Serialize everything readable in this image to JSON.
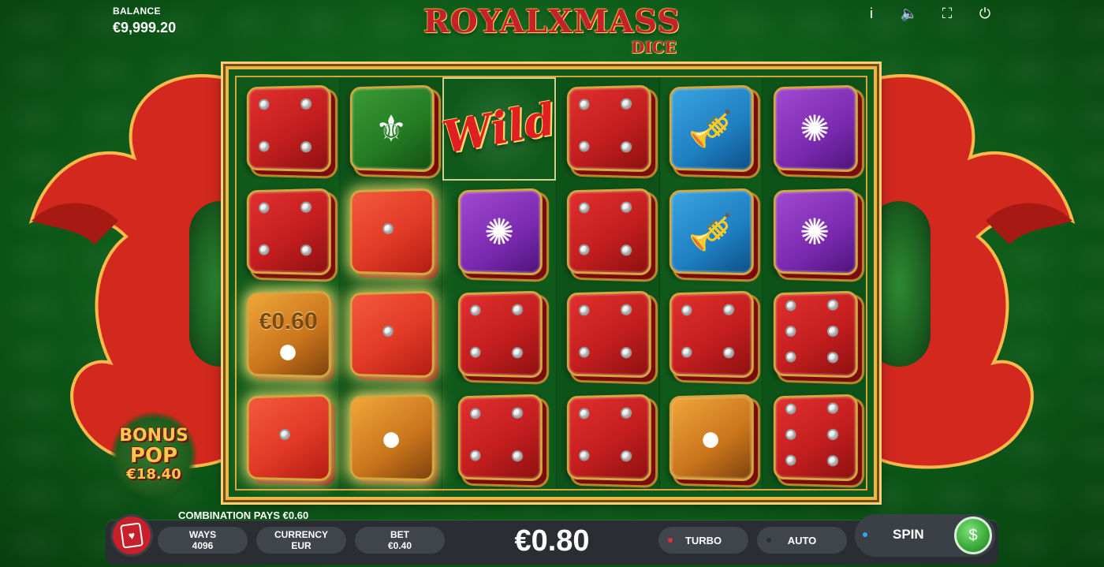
{
  "header": {
    "balance_label": "BALANCE",
    "balance_value": "€9,999.20",
    "logo_main": "ROYALXMASS",
    "logo_sub": "DICE",
    "icons": [
      {
        "name": "info-icon",
        "glyph": "i"
      },
      {
        "name": "sound-icon",
        "glyph": "🔈"
      },
      {
        "name": "fullscreen-icon",
        "glyph": "⛶"
      },
      {
        "name": "power-icon",
        "glyph": "⏻"
      }
    ]
  },
  "grid": {
    "rows": [
      [
        {
          "type": "die",
          "color": "red",
          "pips": 4,
          "win": false
        },
        {
          "type": "symbol",
          "color": "green",
          "icon": "scepter-icon",
          "glyph": "⚜",
          "win": false
        },
        {
          "type": "wild",
          "label": "Wild",
          "win": true
        },
        {
          "type": "die",
          "color": "red",
          "pips": 4,
          "win": false
        },
        {
          "type": "symbol",
          "color": "blue",
          "icon": "trumpet-icon",
          "glyph": "🎺",
          "win": false
        },
        {
          "type": "symbol",
          "color": "purple",
          "icon": "jewel-icon",
          "glyph": "✺",
          "win": false
        }
      ],
      [
        {
          "type": "die",
          "color": "red",
          "pips": 4,
          "win": false
        },
        {
          "type": "die",
          "color": "red",
          "pips": 1,
          "win": true
        },
        {
          "type": "symbol",
          "color": "purple",
          "icon": "jewel-icon",
          "glyph": "✺",
          "win": false
        },
        {
          "type": "die",
          "color": "red",
          "pips": 4,
          "win": false
        },
        {
          "type": "symbol",
          "color": "blue",
          "icon": "trumpet-icon",
          "glyph": "🎺",
          "win": false
        },
        {
          "type": "symbol",
          "color": "purple",
          "icon": "jewel-icon",
          "glyph": "✺",
          "win": false
        }
      ],
      [
        {
          "type": "prize",
          "color": "gold",
          "label": "€0.60",
          "icon": "orb-icon",
          "glyph": "●",
          "win": true
        },
        {
          "type": "die",
          "color": "red",
          "pips": 1,
          "win": true
        },
        {
          "type": "die",
          "color": "red",
          "pips": 4,
          "win": false
        },
        {
          "type": "die",
          "color": "red",
          "pips": 4,
          "win": false
        },
        {
          "type": "die",
          "color": "red",
          "pips": 4,
          "win": false
        },
        {
          "type": "die",
          "color": "red",
          "pips": 6,
          "win": false
        }
      ],
      [
        {
          "type": "die",
          "color": "red",
          "pips": 1,
          "win": true
        },
        {
          "type": "symbol",
          "color": "gold",
          "icon": "orb-icon",
          "glyph": "●",
          "win": true
        },
        {
          "type": "die",
          "color": "red",
          "pips": 4,
          "win": false
        },
        {
          "type": "die",
          "color": "red",
          "pips": 4,
          "win": false
        },
        {
          "type": "symbol",
          "color": "gold",
          "icon": "orb-icon",
          "glyph": "●",
          "win": false
        },
        {
          "type": "die",
          "color": "red",
          "pips": 6,
          "win": false
        }
      ]
    ]
  },
  "bonus_pop": {
    "line1": "BONUS",
    "line2": "POP",
    "amount": "€18.40"
  },
  "footer": {
    "pays_message": "COMBINATION PAYS €0.60",
    "ways_label": "WAYS",
    "ways_value": "4096",
    "currency_label": "CURRENCY",
    "currency_value": "EUR",
    "bet_label": "BET",
    "bet_value": "€0.40",
    "win_amount": "€0.80",
    "turbo_label": "TURBO",
    "auto_label": "AUTO",
    "spin_label": "SPIN",
    "spin_icon_glyph": "$",
    "menu_icon_glyph": "♥"
  },
  "colors": {
    "turbo_dot": "#e0323a",
    "auto_dot": "#2b2f35",
    "spin_dot": "#36a3ff"
  }
}
